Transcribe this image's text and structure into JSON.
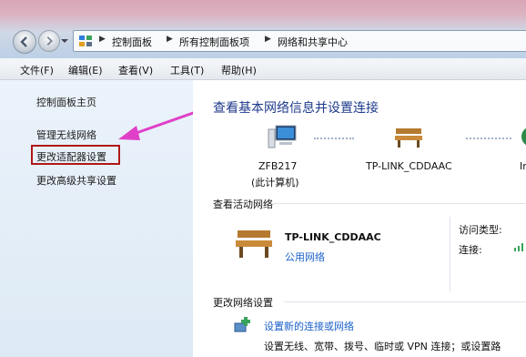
{
  "address": {
    "crumbs": [
      "控制面板",
      "所有控制面板项",
      "网络和共享中心"
    ]
  },
  "menu": [
    "文件(F)",
    "编辑(E)",
    "查看(V)",
    "工具(T)",
    "帮助(H)"
  ],
  "left_links": {
    "home": "控制面板主页",
    "wireless": "管理无线网络",
    "adapter": "更改适配器设置",
    "sharing": "更改高级共享设置"
  },
  "main": {
    "title": "查看基本网络信息并设置连接",
    "map": {
      "computer_name": "ZFB217",
      "computer_sub": "(此计算机)",
      "router_name": "TP-LINK_CDDAAC",
      "internet_cut": "In"
    },
    "active_header": "查看活动网络",
    "network_name": "TP-LINK_CDDAAC",
    "network_type": "公用网络",
    "access_type_label": "访问类型:",
    "connection_label": "连接:",
    "change_header": "更改网络设置",
    "setup_link": "设置新的连接或网络",
    "setup_desc": "设置无线、宽带、拨号、临时或 VPN 连接；或设置路"
  },
  "colors": {
    "link": "#1a61c9",
    "title": "#1e3a8a",
    "highlight_box": "#b01818",
    "arrow": "#e040c8"
  }
}
